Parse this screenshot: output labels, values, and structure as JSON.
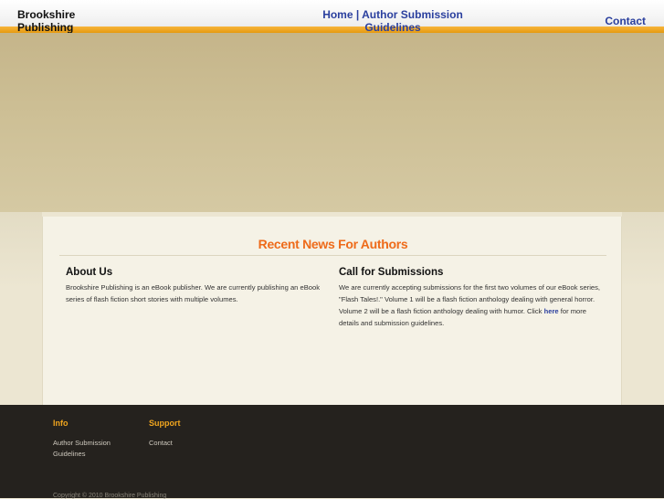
{
  "header": {
    "brand": "Brookshire Publishing",
    "nav_home": "Home",
    "nav_separator": "|",
    "nav_author_submission": "Author Submission Guidelines",
    "nav_contact": "Contact"
  },
  "main": {
    "news_title": "Recent News For Authors",
    "about": {
      "heading": "About Us",
      "text": "Brookshire Publishing is an eBook publisher. We are currently publishing an eBook series of flash fiction short stories with multiple volumes."
    },
    "call": {
      "heading": "Call for Submissions",
      "text_before": "We are currently accepting submissions for the first two volumes of our eBook series, \"Flash Tales!.\" Volume 1 will be a flash fiction anthology dealing with general horror. Volume 2 will be a flash fiction anthology dealing with humor. Click",
      "link": "here",
      "text_after": "for more details and submission guidelines."
    }
  },
  "footer": {
    "info_heading": "Info",
    "info_link": "Author Submission Guidelines",
    "support_heading": "Support",
    "support_link": "Contact",
    "copyright": "Copyright © 2010 Brookshire Publishing"
  },
  "colors": {
    "accent_orange": "#ee6b1a",
    "nav_blue": "#2a3f9e",
    "footer_bg": "#25221e",
    "footer_heading": "#f0a51e"
  }
}
